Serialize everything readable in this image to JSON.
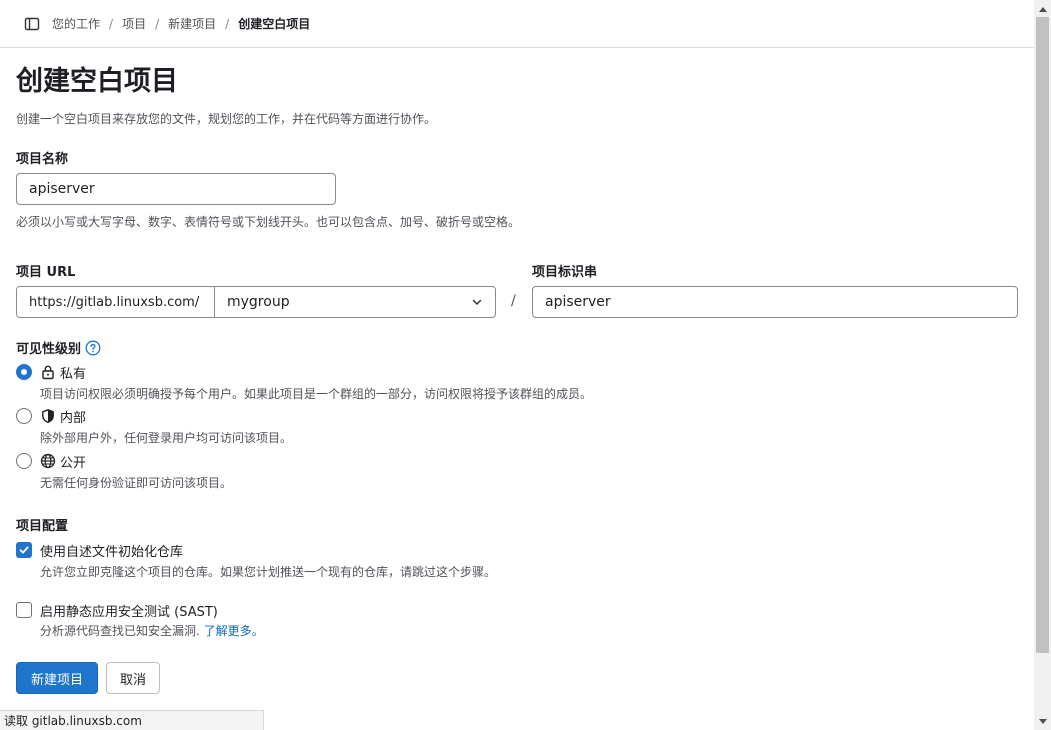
{
  "breadcrumb": {
    "items": [
      "您的工作",
      "项目",
      "新建项目"
    ],
    "current": "创建空白项目",
    "separator": "/"
  },
  "page": {
    "title": "创建空白项目",
    "description": "创建一个空白项目来存放您的文件，规划您的工作，并在代码等方面进行协作。"
  },
  "project_name": {
    "label": "项目名称",
    "value": "apiserver",
    "help": "必须以小写或大写字母、数字、表情符号或下划线开头。也可以包含点、加号、破折号或空格。"
  },
  "project_url": {
    "label": "项目 URL",
    "prefix": "https://gitlab.linuxsb.com/",
    "namespace": "mygroup",
    "separator": "/"
  },
  "project_slug": {
    "label": "项目标识串",
    "value": "apiserver"
  },
  "visibility": {
    "label": "可见性级别",
    "options": [
      {
        "label": "私有",
        "desc": "项目访问权限必须明确授予每个用户。如果此项目是一个群组的一部分，访问权限将授予该群组的成员。",
        "checked": true,
        "icon": "lock-icon"
      },
      {
        "label": "内部",
        "desc": "除外部用户外，任何登录用户均可访问该项目。",
        "checked": false,
        "icon": "shield-icon"
      },
      {
        "label": "公开",
        "desc": "无需任何身份验证即可访问该项目。",
        "checked": false,
        "icon": "globe-icon"
      }
    ]
  },
  "config": {
    "label": "项目配置",
    "init_readme": {
      "label": "使用自述文件初始化仓库",
      "desc": "允许您立即克隆这个项目的仓库。如果您计划推送一个现有的仓库，请跳过这个步骤。",
      "checked": true
    },
    "sast": {
      "label": "启用静态应用安全测试 (SAST)",
      "desc": "分析源代码查找已知安全漏洞.",
      "link": "了解更多。",
      "checked": false
    }
  },
  "buttons": {
    "create": "新建项目",
    "cancel": "取消"
  },
  "status_bar": "读取 gitlab.linuxsb.com",
  "colors": {
    "primary": "#1f75cb",
    "link": "#1068bf"
  }
}
